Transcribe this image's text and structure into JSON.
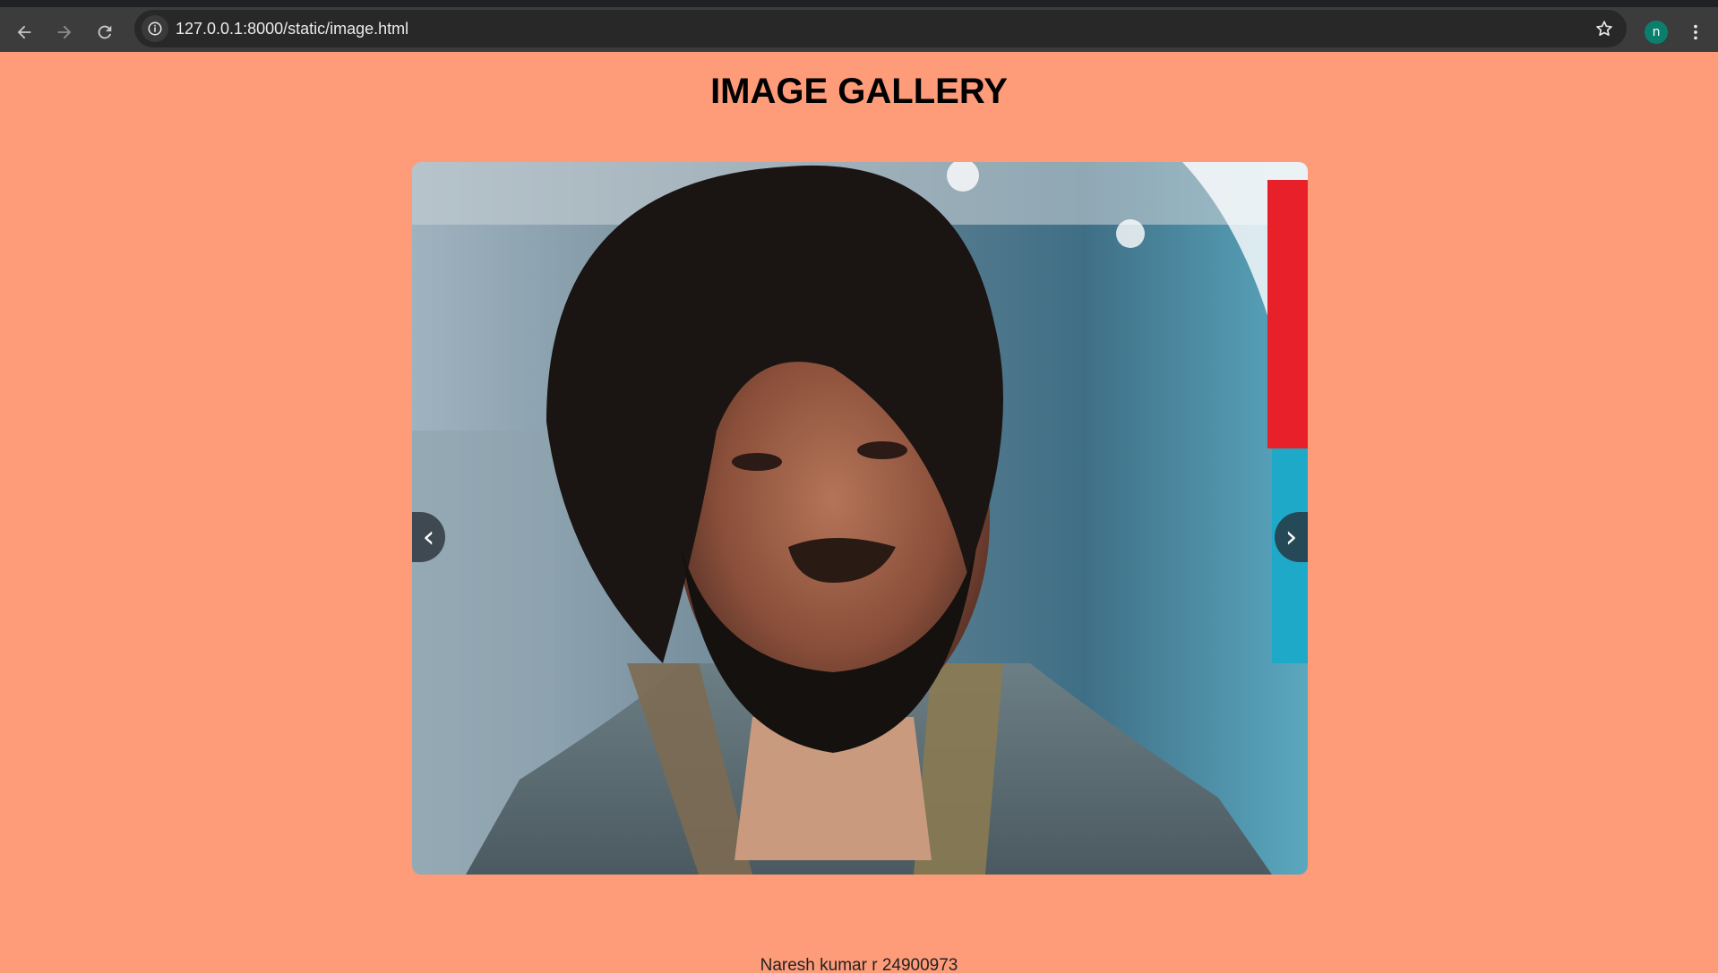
{
  "browser": {
    "url": "127.0.0.1:8000/static/image.html",
    "back_icon": "arrow-left-icon",
    "forward_icon": "arrow-right-icon",
    "reload_icon": "reload-icon",
    "info_icon": "info-icon",
    "bookmark_icon": "star-icon",
    "profile_initial": "n",
    "menu_icon": "more-vertical-icon"
  },
  "page": {
    "title": "IMAGE GALLERY",
    "background_color": "#fe9b79",
    "prev_label": "‹",
    "next_label": "›",
    "footer": "Naresh kumar r 24900973"
  }
}
